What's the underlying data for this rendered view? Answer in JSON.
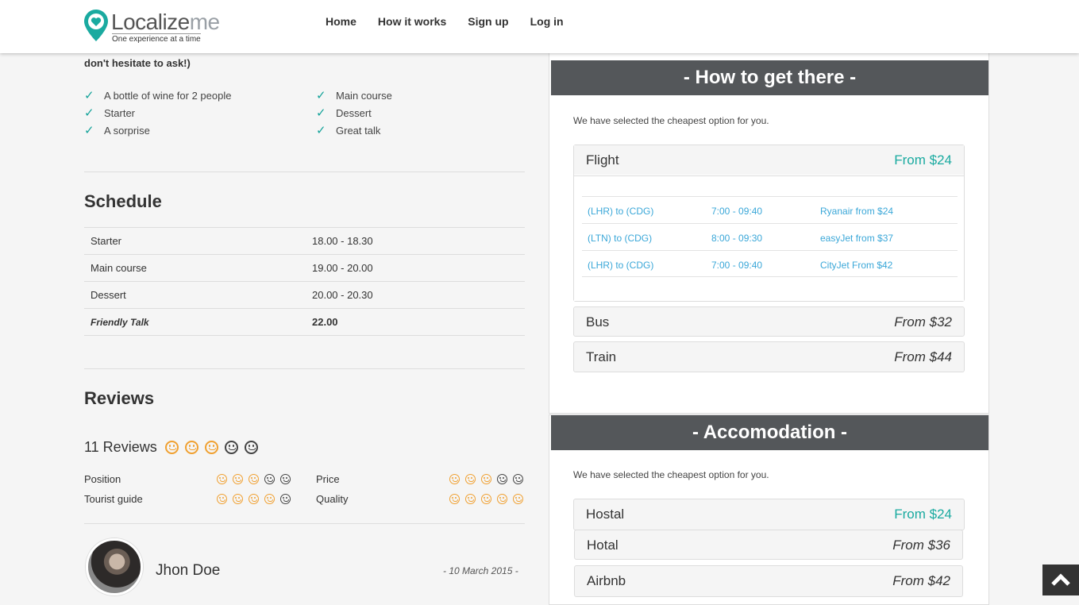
{
  "brand": {
    "name_main": "Localize",
    "name_accent": "me",
    "tagline": "One experience at a time"
  },
  "nav": [
    "Home",
    "How it works",
    "Sign up",
    "Log in"
  ],
  "intro_tail": "don't hesitate to ask!)",
  "includes": [
    "A bottle of wine for 2 people",
    "Main course",
    "Starter",
    "Dessert",
    "A sorprise",
    "Great talk"
  ],
  "schedule": {
    "title": "Schedule",
    "rows": [
      {
        "item": "Starter",
        "time": "18.00 - 18.30"
      },
      {
        "item": "Main course",
        "time": "19.00 - 20.00"
      },
      {
        "item": "Dessert",
        "time": "20.00 - 20.30"
      },
      {
        "item": "Friendly Talk",
        "time": "22.00"
      }
    ]
  },
  "reviews": {
    "title": "Reviews",
    "count_label": "11 Reviews",
    "overall": 3,
    "ratings": [
      {
        "label": "Position",
        "score": 3
      },
      {
        "label": "Price",
        "score": 3
      },
      {
        "label": "Tourist guide",
        "score": 4
      },
      {
        "label": "Quality",
        "score": 5
      }
    ],
    "reviewer": {
      "name": "Jhon Doe",
      "date": "- 10 March 2015 -"
    }
  },
  "transport": {
    "title": "- How to get there -",
    "subtitle": "We have selected the cheapest option for you.",
    "flight": {
      "name": "Flight",
      "price": "From $24",
      "rows": [
        {
          "route": "(LHR) to (CDG)",
          "time": "7:00 - 09:40",
          "carrier": "Ryanair from $24"
        },
        {
          "route": "(LTN) to (CDG)",
          "time": "8:00 - 09:30",
          "carrier": "easyJet from $37"
        },
        {
          "route": "(LHR) to (CDG)",
          "time": "7:00 - 09:40",
          "carrier": "CityJet From $42"
        }
      ]
    },
    "bus": {
      "name": "Bus",
      "price": "From $32"
    },
    "train": {
      "name": "Train",
      "price": "From $44"
    }
  },
  "accommodation": {
    "title": "- Accomodation -",
    "subtitle": "We have selected the cheapest option for you.",
    "options": [
      {
        "name": "Hostal",
        "price": "From $24"
      },
      {
        "name": "Hotal",
        "price": "From $36"
      },
      {
        "name": "Airbnb",
        "price": "From $42"
      }
    ]
  },
  "colors": {
    "accent": "#1aaaa0",
    "link": "#3aa7d8",
    "panel_head": "#54575a",
    "smiley_on": "#f0a030"
  }
}
